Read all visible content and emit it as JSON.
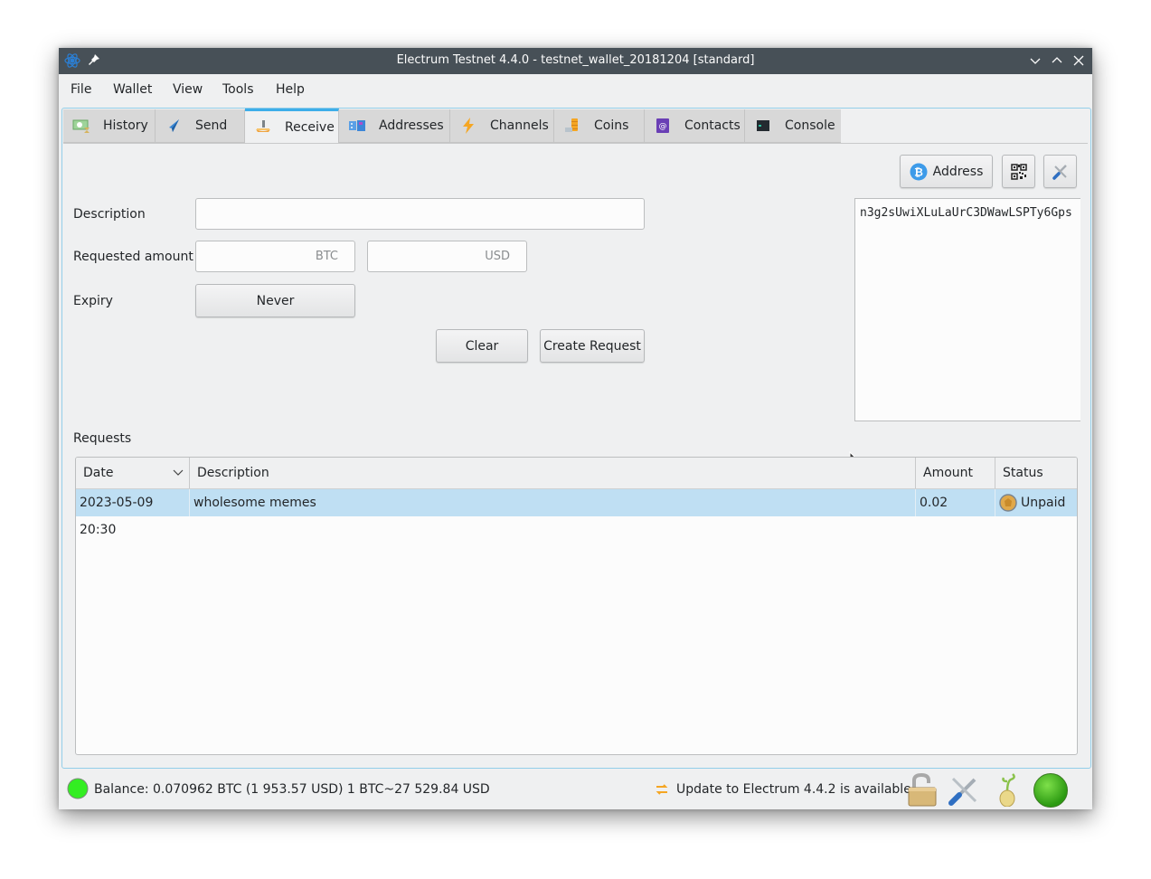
{
  "window": {
    "title": "Electrum Testnet 4.4.0 - testnet_wallet_20181204 [standard]",
    "controls": [
      "minimize",
      "maximize",
      "close"
    ]
  },
  "menu": [
    "File",
    "Wallet",
    "View",
    "Tools",
    "Help"
  ],
  "tabs": [
    {
      "label": "History",
      "icon": "history-icon",
      "active": false
    },
    {
      "label": "Send",
      "icon": "send-icon",
      "active": false
    },
    {
      "label": "Receive",
      "icon": "receive-icon",
      "active": true
    },
    {
      "label": "Addresses",
      "icon": "addresses-icon",
      "active": false
    },
    {
      "label": "Channels",
      "icon": "lightning-icon",
      "active": false
    },
    {
      "label": "Coins",
      "icon": "coins-icon",
      "active": false
    },
    {
      "label": "Contacts",
      "icon": "contacts-icon",
      "active": false
    },
    {
      "label": "Console",
      "icon": "console-icon",
      "active": false
    }
  ],
  "receive": {
    "address_button": "Address",
    "description_label": "Description",
    "description_value": "",
    "amount_label": "Requested amount",
    "amount_btc_placeholder": "BTC",
    "amount_usd_placeholder": "USD",
    "expiry_label": "Expiry",
    "expiry_value": "Never",
    "clear_button": "Clear",
    "create_button": "Create Request",
    "address_text": "n3g2sUwiXLuLaUrC3DWawLSPTy6Gps"
  },
  "requests": {
    "title": "Requests",
    "columns": [
      "Date",
      "Description",
      "Amount",
      "Status"
    ],
    "rows": [
      {
        "date": "2023-05-09 20:30",
        "description": "wholesome memes",
        "amount": "0.02",
        "status": "Unpaid"
      }
    ]
  },
  "status": {
    "balance": "Balance: 0.070962 BTC (1 953.57 USD)  1 BTC~27 529.84 USD",
    "update": "Update to Electrum 4.4.2 is available"
  },
  "colors": {
    "accent": "#3daee9",
    "selection": "#bfdff3",
    "titlebar": "#475057",
    "online": "#33cc33"
  }
}
